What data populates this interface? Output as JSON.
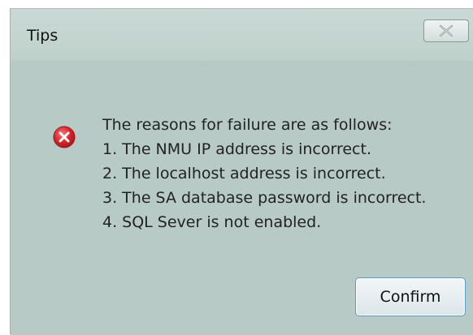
{
  "dialog": {
    "title": "Tips",
    "close_icon": "close-x-icon",
    "error_icon": "error-icon",
    "message_lines": [
      "The reasons for failure are as follows:",
      "1. The NMU IP address is incorrect.",
      "2. The localhost address is incorrect.",
      "3. The SA database password is incorrect.",
      "4. SQL Sever is not enabled."
    ],
    "confirm_label": "Confirm"
  },
  "colors": {
    "background": "#b9cbc6",
    "error_red": "#d9262c",
    "button_border": "#5a9cc4"
  }
}
